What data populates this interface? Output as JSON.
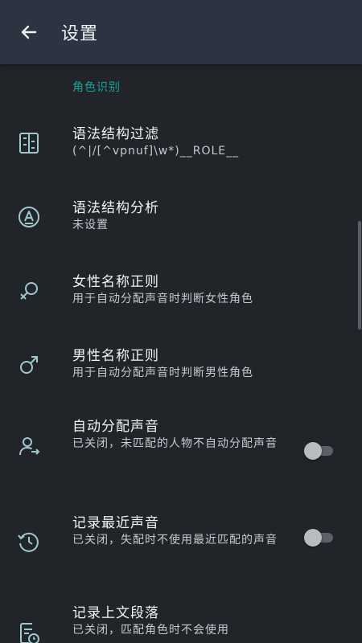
{
  "appbar": {
    "title": "设置",
    "back_icon": "arrow-left-icon"
  },
  "section": {
    "label": "角色识别",
    "accent": "#1aa39b"
  },
  "items": [
    {
      "title": "语法结构过滤",
      "subtitle": "(^|/[^vpnuf]\\w*)__ROLE__",
      "icon": "split-columns-icon"
    },
    {
      "title": "语法结构分析",
      "subtitle": "未设置",
      "icon": "circled-a-icon"
    },
    {
      "title": "女性名称正则",
      "subtitle": "用于自动分配声音时判断女性角色",
      "icon": "female-symbol-icon"
    },
    {
      "title": "男性名称正则",
      "subtitle": "用于自动分配声音时判断男性角色",
      "icon": "male-symbol-icon"
    },
    {
      "title": "自动分配声音",
      "subtitle": "已关闭，未匹配的人物不自动分配声音",
      "icon": "person-arrow-icon",
      "toggle": false
    },
    {
      "title": "记录最近声音",
      "subtitle": "已关闭，失配时不使用最近匹配的声音",
      "icon": "history-clock-icon",
      "toggle": false
    },
    {
      "title": "记录上文段落",
      "subtitle": "已关闭，匹配角色时不会使用",
      "icon": "document-clock-icon"
    }
  ]
}
